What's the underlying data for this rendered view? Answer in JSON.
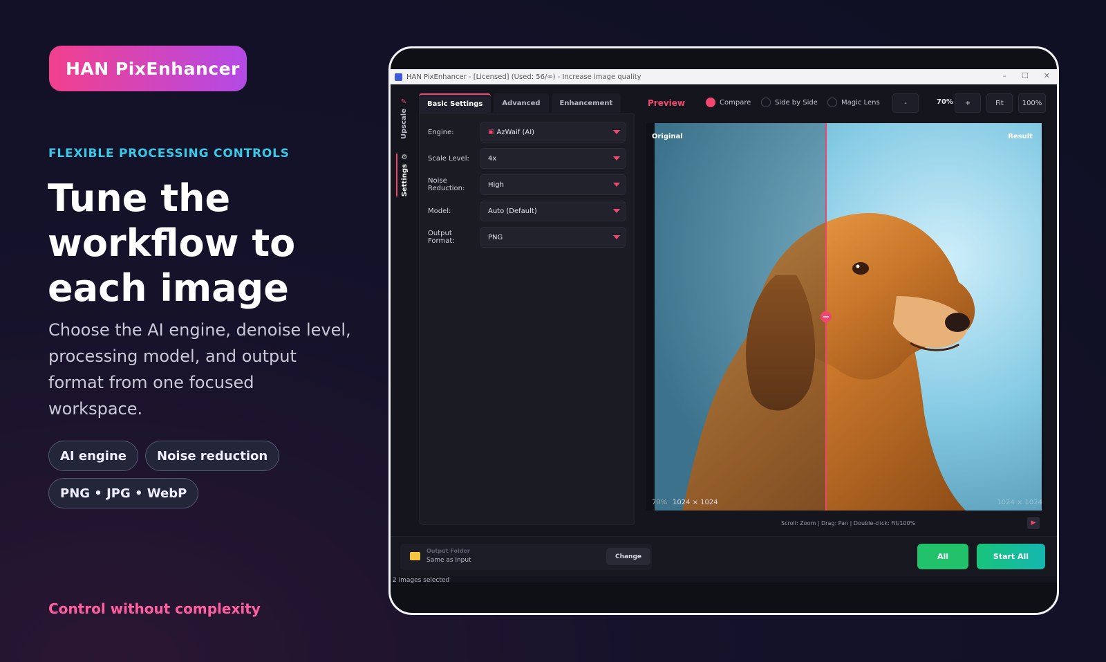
{
  "brand": {
    "name": "HAN PixEnhancer"
  },
  "hero": {
    "eyebrow": "FLEXIBLE PROCESSING CONTROLS",
    "headline": "Tune the workflow to each image",
    "description": "Choose the AI engine, denoise level, processing model, and output format from one focused workspace.",
    "chips": [
      "AI engine",
      "Noise reduction",
      "PNG • JPG • WebP"
    ],
    "tagline": "Control without complexity"
  },
  "window": {
    "title": "HAN PixEnhancer - [Licensed] (Used: 56/∞) - Increase image quality",
    "controls": [
      "–",
      "☐",
      "✕"
    ]
  },
  "rail": {
    "items": [
      "Upscale",
      "Settings"
    ]
  },
  "settings": {
    "tabs": [
      "Basic Settings",
      "Advanced",
      "Enhancement"
    ],
    "fields": [
      {
        "label": "Engine:",
        "value": "AzWaif (AI)"
      },
      {
        "label": "Scale Level:",
        "value": "4x"
      },
      {
        "label": "Noise Reduction:",
        "value": "High"
      },
      {
        "label": "Model:",
        "value": "Auto (Default)"
      },
      {
        "label": "Output Format:",
        "value": "PNG"
      }
    ]
  },
  "preview": {
    "title": "Preview",
    "modes": [
      "Compare",
      "Side by Side",
      "Magic Lens"
    ],
    "selected_mode": "Compare",
    "zoom": {
      "minus": "-",
      "value": "70%",
      "plus": "+",
      "fit": "Fit",
      "full": "100%"
    },
    "label_left": "Original",
    "label_right": "Result",
    "zoom_overlay": "70%",
    "dims_left": "1024 × 1024",
    "dims_right": "1024 × 1024",
    "hint": "Scroll: Zoom  |  Drag: Pan  |  Double-click: Fit/100%"
  },
  "output": {
    "caption": "Output Folder",
    "value": "Same as input",
    "change_label": "Change"
  },
  "actions": {
    "all": "All",
    "start_all": "Start All"
  },
  "status": "2 images selected",
  "colors": {
    "accent": "#f0476e",
    "cyan": "#38c9e8",
    "green": "#22c26a"
  }
}
